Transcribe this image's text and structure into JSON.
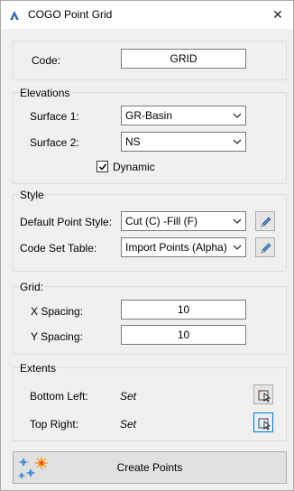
{
  "window": {
    "title": "COGO Point Grid",
    "close_glyph": "✕"
  },
  "code": {
    "label": "Code:",
    "value": "GRID"
  },
  "elevations": {
    "group_title": "Elevations",
    "surface1_label": "Surface 1:",
    "surface1_value": "GR-Basin",
    "surface2_label": "Surface 2:",
    "surface2_value": "NS",
    "dynamic_label": "Dynamic",
    "dynamic_checked": true
  },
  "style": {
    "group_title": "Style",
    "default_point_style_label": "Default Point Style:",
    "default_point_style_value": "Cut (C) -Fill (F)",
    "code_set_table_label": "Code Set Table:",
    "code_set_table_value": "Import Points (Alpha)"
  },
  "grid": {
    "group_title": "Grid:",
    "x_spacing_label": "X Spacing:",
    "x_spacing_value": "10",
    "y_spacing_label": "Y Spacing:",
    "y_spacing_value": "10"
  },
  "extents": {
    "group_title": "Extents",
    "bottom_left_label": "Bottom Left:",
    "bottom_left_value": "Set",
    "top_right_label": "Top Right:",
    "top_right_value": "Set"
  },
  "actions": {
    "create_points_label": "Create Points"
  },
  "icons": {
    "app": "app-logo-icon",
    "close": "close-icon",
    "chevron": "chevron-down-icon",
    "edit": "pencil-icon",
    "pick": "pick-point-icon",
    "create": "create-points-icon"
  },
  "colors": {
    "titlebar_bg": "#ffffff",
    "dialog_bg": "#f0f0f0",
    "accent_border": "#0078d7"
  }
}
